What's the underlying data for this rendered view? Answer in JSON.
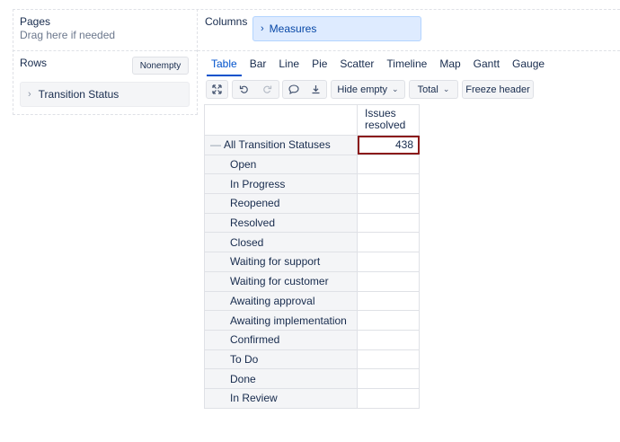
{
  "pages": {
    "label": "Pages",
    "hint": "Drag here if needed"
  },
  "columns": {
    "label": "Columns",
    "chip": "Measures"
  },
  "rows": {
    "label": "Rows",
    "nonempty_label": "Nonempty",
    "chip": "Transition Status"
  },
  "tabs": [
    {
      "label": "Table",
      "active": true
    },
    {
      "label": "Bar"
    },
    {
      "label": "Line"
    },
    {
      "label": "Pie"
    },
    {
      "label": "Scatter"
    },
    {
      "label": "Timeline"
    },
    {
      "label": "Map"
    },
    {
      "label": "Gantt"
    },
    {
      "label": "Gauge"
    }
  ],
  "toolbar": {
    "hide_empty": "Hide empty",
    "total": "Total",
    "freeze_header": "Freeze header",
    "icons": [
      "expand-icon",
      "undo-icon",
      "redo-icon",
      "comment-icon",
      "download-icon"
    ]
  },
  "table": {
    "measure_header": "Issues resolved",
    "total_row": {
      "label": "All Transition Statuses",
      "value": "438"
    },
    "rows": [
      {
        "label": "Open",
        "value": ""
      },
      {
        "label": "In Progress",
        "value": ""
      },
      {
        "label": "Reopened",
        "value": ""
      },
      {
        "label": "Resolved",
        "value": ""
      },
      {
        "label": "Closed",
        "value": ""
      },
      {
        "label": "Waiting for support",
        "value": ""
      },
      {
        "label": "Waiting for customer",
        "value": ""
      },
      {
        "label": "Awaiting approval",
        "value": ""
      },
      {
        "label": "Awaiting implementation",
        "value": ""
      },
      {
        "label": "Confirmed",
        "value": ""
      },
      {
        "label": "To Do",
        "value": ""
      },
      {
        "label": "Done",
        "value": ""
      },
      {
        "label": "In Review",
        "value": ""
      }
    ]
  },
  "colors": {
    "accent": "#0052cc",
    "chip_bg": "#deebff",
    "selected_outline": "#8b1a1a"
  }
}
